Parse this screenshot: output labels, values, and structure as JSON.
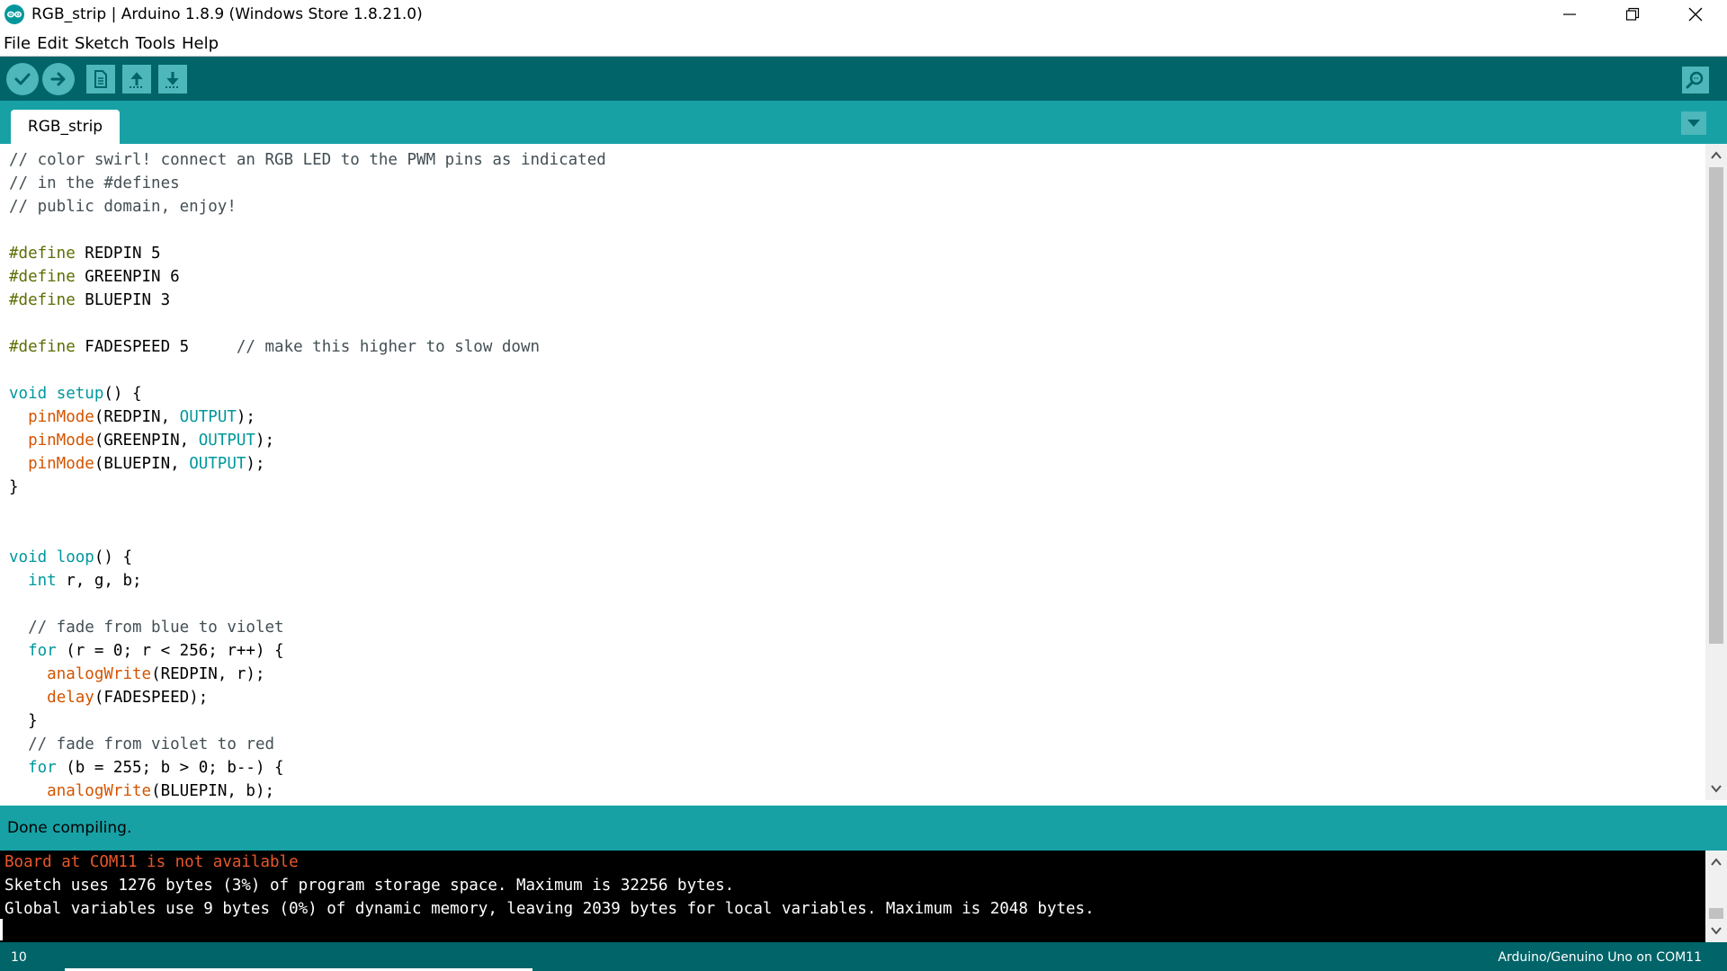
{
  "window": {
    "title": "RGB_strip | Arduino 1.8.9 (Windows Store 1.8.21.0)",
    "logo_icon": "arduino-logo-icon",
    "controls": [
      "minimize-icon",
      "restore-icon",
      "close-icon"
    ]
  },
  "menu": {
    "file": "File",
    "edit": "Edit",
    "sketch": "Sketch",
    "tools": "Tools",
    "help": "Help"
  },
  "toolbar": {
    "buttons": [
      "verify-icon",
      "upload-icon",
      "new-icon",
      "open-icon",
      "save-icon"
    ],
    "serial_monitor": "serial-monitor-icon",
    "colors": {
      "bar": "#006468",
      "button": "#4db7bb"
    }
  },
  "tabs": {
    "active": "RGB_strip",
    "menu_icon": "chevron-down-icon"
  },
  "editor": {
    "lines": [
      [
        {
          "t": "// color swirl! connect an RGB LED to the PWM pins as indicated",
          "c": "comment"
        }
      ],
      [
        {
          "t": "// in the #defines",
          "c": "comment"
        }
      ],
      [
        {
          "t": "// public domain, enjoy!",
          "c": "comment"
        }
      ],
      [],
      [
        {
          "t": "#define",
          "c": "prep"
        },
        {
          "t": " REDPIN 5",
          "c": "plain"
        }
      ],
      [
        {
          "t": "#define",
          "c": "prep"
        },
        {
          "t": " GREENPIN 6",
          "c": "plain"
        }
      ],
      [
        {
          "t": "#define",
          "c": "prep"
        },
        {
          "t": " BLUEPIN 3",
          "c": "plain"
        }
      ],
      [],
      [
        {
          "t": "#define",
          "c": "prep"
        },
        {
          "t": " FADESPEED 5     ",
          "c": "plain"
        },
        {
          "t": "// make this higher to slow down",
          "c": "comment"
        }
      ],
      [],
      [
        {
          "t": "void",
          "c": "keyword"
        },
        {
          "t": " ",
          "c": "plain"
        },
        {
          "t": "setup",
          "c": "keyword"
        },
        {
          "t": "() {",
          "c": "plain"
        }
      ],
      [
        {
          "t": "  ",
          "c": "plain"
        },
        {
          "t": "pinMode",
          "c": "func"
        },
        {
          "t": "(REDPIN, ",
          "c": "plain"
        },
        {
          "t": "OUTPUT",
          "c": "const"
        },
        {
          "t": ");",
          "c": "plain"
        }
      ],
      [
        {
          "t": "  ",
          "c": "plain"
        },
        {
          "t": "pinMode",
          "c": "func"
        },
        {
          "t": "(GREENPIN, ",
          "c": "plain"
        },
        {
          "t": "OUTPUT",
          "c": "const"
        },
        {
          "t": ");",
          "c": "plain"
        }
      ],
      [
        {
          "t": "  ",
          "c": "plain"
        },
        {
          "t": "pinMode",
          "c": "func"
        },
        {
          "t": "(BLUEPIN, ",
          "c": "plain"
        },
        {
          "t": "OUTPUT",
          "c": "const"
        },
        {
          "t": ");",
          "c": "plain"
        }
      ],
      [
        {
          "t": "}",
          "c": "plain"
        }
      ],
      [],
      [],
      [
        {
          "t": "void",
          "c": "keyword"
        },
        {
          "t": " ",
          "c": "plain"
        },
        {
          "t": "loop",
          "c": "keyword"
        },
        {
          "t": "() {",
          "c": "plain"
        }
      ],
      [
        {
          "t": "  ",
          "c": "plain"
        },
        {
          "t": "int",
          "c": "keyword"
        },
        {
          "t": " r, g, b;",
          "c": "plain"
        }
      ],
      [],
      [
        {
          "t": "  ",
          "c": "plain"
        },
        {
          "t": "// fade from blue to violet",
          "c": "comment"
        }
      ],
      [
        {
          "t": "  ",
          "c": "plain"
        },
        {
          "t": "for",
          "c": "keyword"
        },
        {
          "t": " (r = 0; r < 256; r++) {",
          "c": "plain"
        }
      ],
      [
        {
          "t": "    ",
          "c": "plain"
        },
        {
          "t": "analogWrite",
          "c": "func"
        },
        {
          "t": "(REDPIN, r);",
          "c": "plain"
        }
      ],
      [
        {
          "t": "    ",
          "c": "plain"
        },
        {
          "t": "delay",
          "c": "func"
        },
        {
          "t": "(FADESPEED);",
          "c": "plain"
        }
      ],
      [
        {
          "t": "  }",
          "c": "plain"
        }
      ],
      [
        {
          "t": "  ",
          "c": "plain"
        },
        {
          "t": "// fade from violet to red",
          "c": "comment"
        }
      ],
      [
        {
          "t": "  ",
          "c": "plain"
        },
        {
          "t": "for",
          "c": "keyword"
        },
        {
          "t": " (b = 255; b > 0; b--) {",
          "c": "plain"
        }
      ],
      [
        {
          "t": "    ",
          "c": "plain"
        },
        {
          "t": "analogWrite",
          "c": "func"
        },
        {
          "t": "(BLUEPIN, b);",
          "c": "plain"
        }
      ]
    ]
  },
  "status": {
    "message": "Done compiling."
  },
  "console": {
    "lines": [
      {
        "text": "Board at COM11 is not available",
        "color": "#e8572b"
      },
      {
        "text": "Sketch uses 1276 bytes (3%) of program storage space. Maximum is 32256 bytes.",
        "color": "#ffffff"
      },
      {
        "text": "Global variables use 9 bytes (0%) of dynamic memory, leaving 2039 bytes for local variables. Maximum is 2048 bytes.",
        "color": "#ffffff"
      }
    ]
  },
  "footer": {
    "line_number": "10",
    "board": "Arduino/Genuino Uno on COM11"
  }
}
